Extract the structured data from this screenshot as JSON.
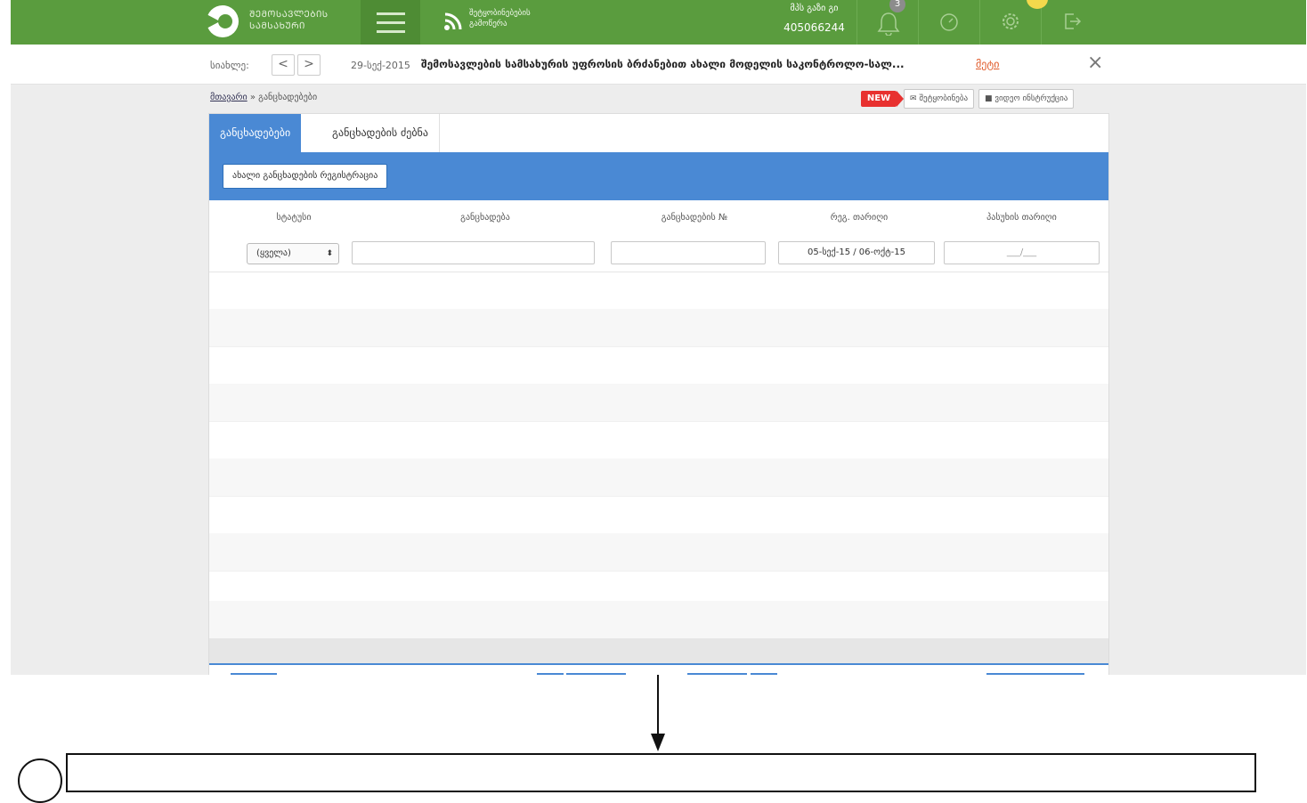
{
  "header": {
    "logo_text_line1": "ᲨᲔᲛᲝᲡᲐᲕᲚᲔᲑᲘᲡ",
    "logo_text_line2": "ᲡᲐᲛᲡᲐᲮᲣᲠᲘ",
    "rss_line1": "შეტყობინებების",
    "rss_line2": "გამოწერა",
    "user_name": "მპს გაზი გი",
    "user_id": "405066244",
    "notification_count": "3",
    "brand_color": "#5a9c3e"
  },
  "news": {
    "label": "სიახლე:",
    "prev": "<",
    "next": ">",
    "date": "29-სექ-2015",
    "title": "შემოსავლების სამსახურის უფროსის ბრძანებით ახალი მოდელის საკონტროლო-სალ...",
    "more": "მეტი",
    "close": "×"
  },
  "breadcrumb": {
    "home": "მთავარი",
    "separator": "»",
    "current": "განცხადებები"
  },
  "toolbar": {
    "new_tag": "NEW",
    "messages_btn": "✉ შეტყობინება",
    "video_btn": "■ ვიდეო ინსტრუქცია"
  },
  "tabs": [
    {
      "label": "განცხადებები",
      "active": true
    },
    {
      "label": "განცხადების ძებნა",
      "active": false
    }
  ],
  "register_button": "ახალი განცხადების რეგისტრაცია",
  "table": {
    "columns": [
      "სტატუსი",
      "განცხადება",
      "განცხადების №",
      "რეგ. თარიღი",
      "პასუხის თარიღი"
    ],
    "filters": {
      "status_selected": "(ყველა)",
      "date_range": "05-სექ-15 / 06-ოქტ-15",
      "answer_date_placeholder": "___/___"
    }
  },
  "accent_color": "#4a89d4"
}
